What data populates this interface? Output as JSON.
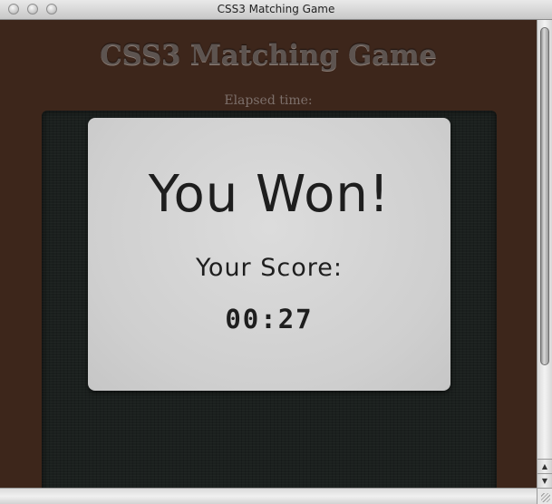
{
  "window": {
    "title": "CSS3 Matching Game"
  },
  "page": {
    "heading": "CSS3 Matching Game",
    "elapsed_label": "Elapsed time:"
  },
  "dialog": {
    "title": "You Won!",
    "score_label": "Your Score:",
    "score_value": "00:27"
  },
  "colors": {
    "page_background": "#3d261b",
    "board_background": "#1b201e",
    "dialog_background": "#d3d3d3",
    "dialog_text": "#1e1e1e",
    "heading_text": "#5d5450"
  },
  "icons": {
    "close": "traffic-light-close-icon",
    "minimize": "traffic-light-minimize-icon",
    "zoom": "traffic-light-zoom-icon",
    "scroll_up": "arrow-up-icon",
    "scroll_down": "arrow-down-icon",
    "resize": "resize-grip-icon"
  }
}
